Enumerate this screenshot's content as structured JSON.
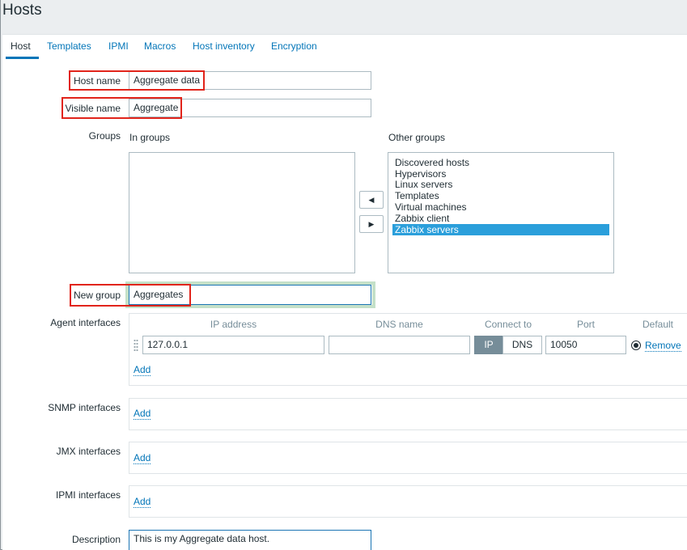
{
  "page": {
    "title": "Hosts"
  },
  "tabs": [
    {
      "label": "Host"
    },
    {
      "label": "Templates"
    },
    {
      "label": "IPMI"
    },
    {
      "label": "Macros"
    },
    {
      "label": "Host inventory"
    },
    {
      "label": "Encryption"
    }
  ],
  "form": {
    "host_name": {
      "label": "Host name",
      "value": "Aggregate data"
    },
    "visible_name": {
      "label": "Visible name",
      "value": "Aggregate"
    },
    "groups": {
      "label": "Groups",
      "in_groups_label": "In groups",
      "other_groups_label": "Other groups",
      "in_groups": [],
      "other_groups": [
        "Discovered hosts",
        "Hypervisors",
        "Linux servers",
        "Templates",
        "Virtual machines",
        "Zabbix client",
        "Zabbix servers"
      ],
      "selected_other_group": "Zabbix servers",
      "move_left_symbol": "◀",
      "move_right_symbol": "▶"
    },
    "new_group": {
      "label": "New group",
      "value": "Aggregates"
    },
    "agent_interfaces": {
      "label": "Agent interfaces",
      "columns": {
        "ip": "IP address",
        "dns": "DNS name",
        "connect": "Connect to",
        "port": "Port",
        "default": "Default"
      },
      "row": {
        "ip": "127.0.0.1",
        "dns": "",
        "connect_ip": "IP",
        "connect_dns": "DNS",
        "port": "10050",
        "remove": "Remove"
      },
      "add": "Add"
    },
    "snmp_interfaces": {
      "label": "SNMP interfaces",
      "add": "Add"
    },
    "jmx_interfaces": {
      "label": "JMX interfaces",
      "add": "Add"
    },
    "ipmi_interfaces": {
      "label": "IPMI interfaces",
      "add": "Add"
    },
    "description": {
      "label": "Description",
      "value": "This is my Aggregate data host."
    }
  },
  "colors": {
    "accent": "#0275b8",
    "highlight": "#e1241b",
    "selection": "#2b9fdb"
  }
}
